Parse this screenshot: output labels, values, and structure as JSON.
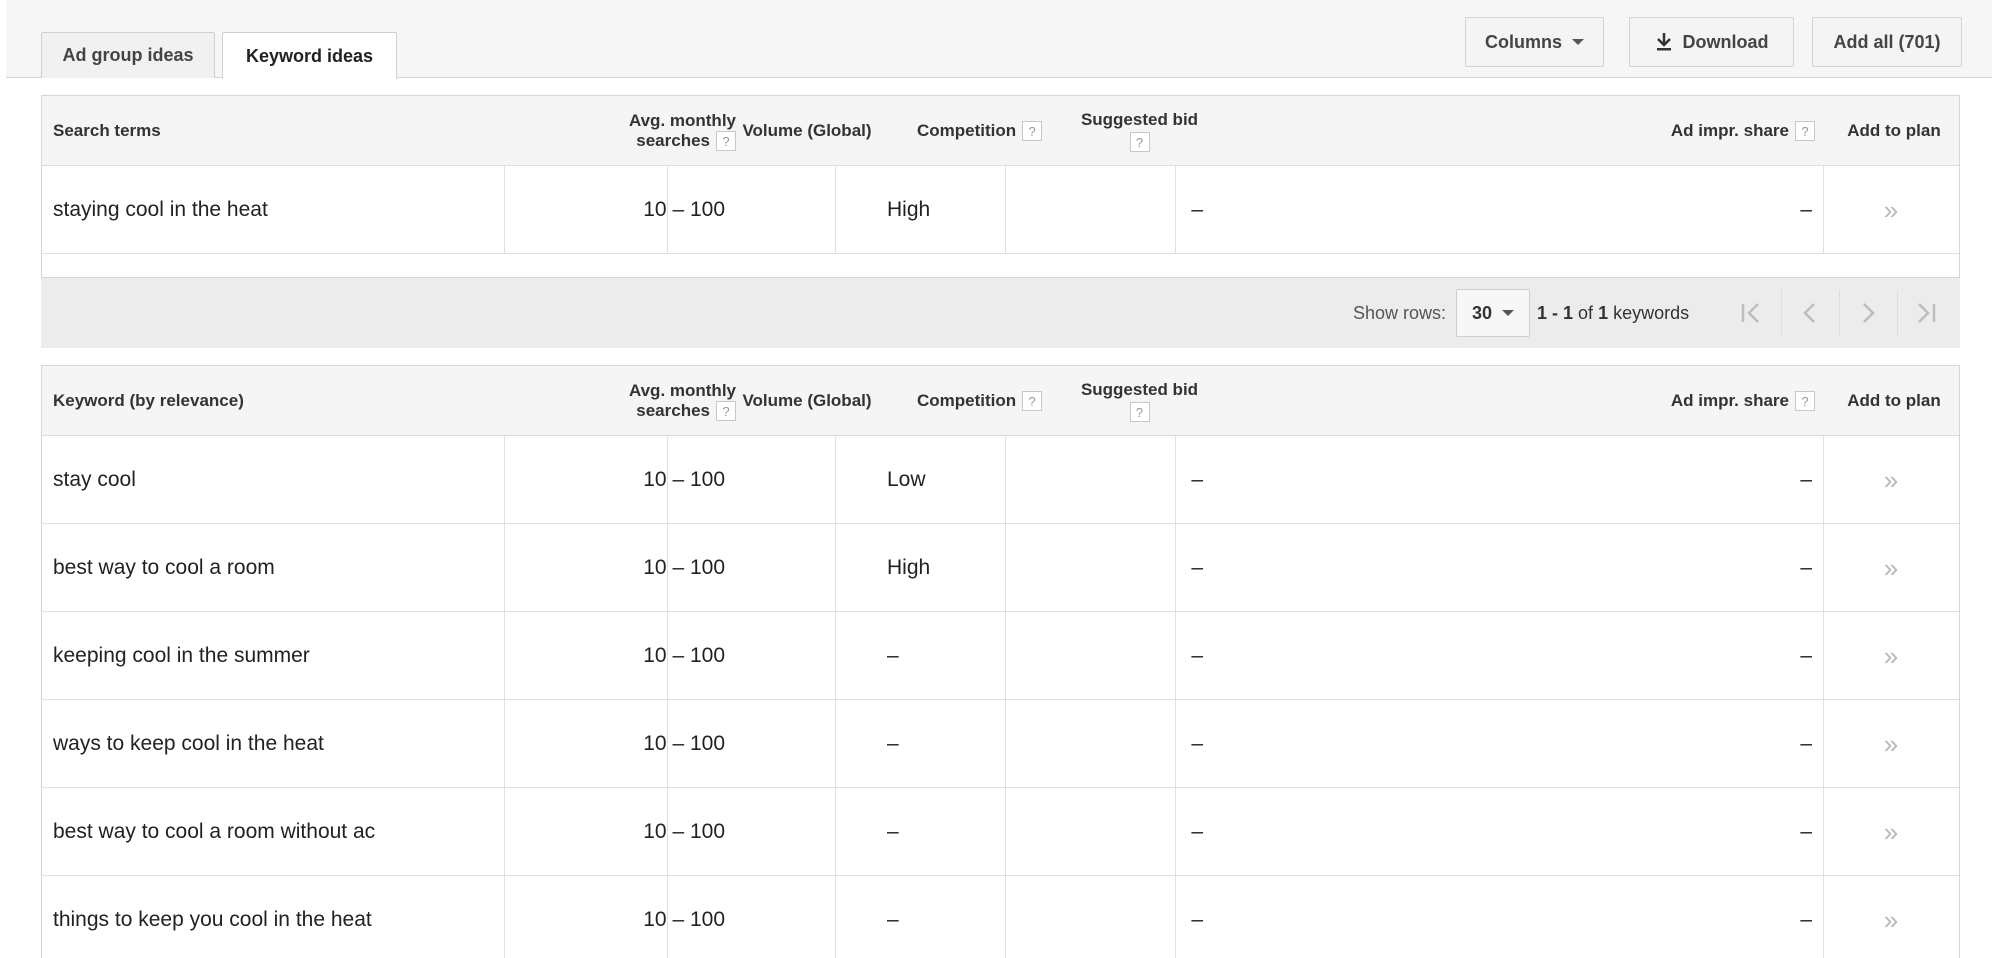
{
  "tabs": [
    {
      "label": "Ad group ideas",
      "active": false
    },
    {
      "label": "Keyword ideas",
      "active": true
    }
  ],
  "toolbar": {
    "columns_label": "Columns",
    "download_label": "Download",
    "add_all_label": "Add all (701)"
  },
  "search_table": {
    "headers": {
      "term": "Search terms",
      "avg_line1": "Avg. monthly",
      "avg_line2": "searches",
      "volume": "Volume (Global)",
      "competition": "Competition",
      "bid_line1": "Suggested bid",
      "ad_impr": "Ad impr. share",
      "add_to_plan": "Add to plan"
    },
    "rows": [
      {
        "term": "staying cool in the heat",
        "avg": "10 – 100",
        "volume": "",
        "competition": "High",
        "bid": "–",
        "ad_impr": "–",
        "plan": "»"
      }
    ]
  },
  "pager": {
    "show_rows_label": "Show rows:",
    "rows_value": "30",
    "info_prefix": "1 - 1",
    "info_of": "of",
    "info_total": "1",
    "info_suffix": "keywords"
  },
  "keyword_table": {
    "headers": {
      "term": "Keyword (by relevance)",
      "avg_line1": "Avg. monthly",
      "avg_line2": "searches",
      "volume": "Volume (Global)",
      "competition": "Competition",
      "bid_line1": "Suggested bid",
      "ad_impr": "Ad impr. share",
      "add_to_plan": "Add to plan"
    },
    "rows": [
      {
        "term": "stay cool",
        "avg": "10 – 100",
        "volume": "",
        "competition": "Low",
        "bid": "–",
        "ad_impr": "–",
        "plan": "»"
      },
      {
        "term": "best way to cool a room",
        "avg": "10 – 100",
        "volume": "",
        "competition": "High",
        "bid": "–",
        "ad_impr": "–",
        "plan": "»"
      },
      {
        "term": "keeping cool in the summer",
        "avg": "10 – 100",
        "volume": "",
        "competition": "–",
        "bid": "–",
        "ad_impr": "–",
        "plan": "»"
      },
      {
        "term": "ways to keep cool in the heat",
        "avg": "10 – 100",
        "volume": "",
        "competition": "–",
        "bid": "–",
        "ad_impr": "–",
        "plan": "»"
      },
      {
        "term": "best way to cool a room without ac",
        "avg": "10 – 100",
        "volume": "",
        "competition": "–",
        "bid": "–",
        "ad_impr": "–",
        "plan": "»"
      },
      {
        "term": "things to keep you cool in the heat",
        "avg": "10 – 100",
        "volume": "",
        "competition": "–",
        "bid": "–",
        "ad_impr": "–",
        "plan": "»"
      }
    ]
  },
  "icons": {
    "help": "question-mark-icon",
    "download": "download-icon",
    "dropdown": "caret-down-icon",
    "add": "double-chevron-right-icon",
    "first": "first-page-icon",
    "prev": "prev-page-icon",
    "next": "next-page-icon",
    "last": "last-page-icon"
  }
}
